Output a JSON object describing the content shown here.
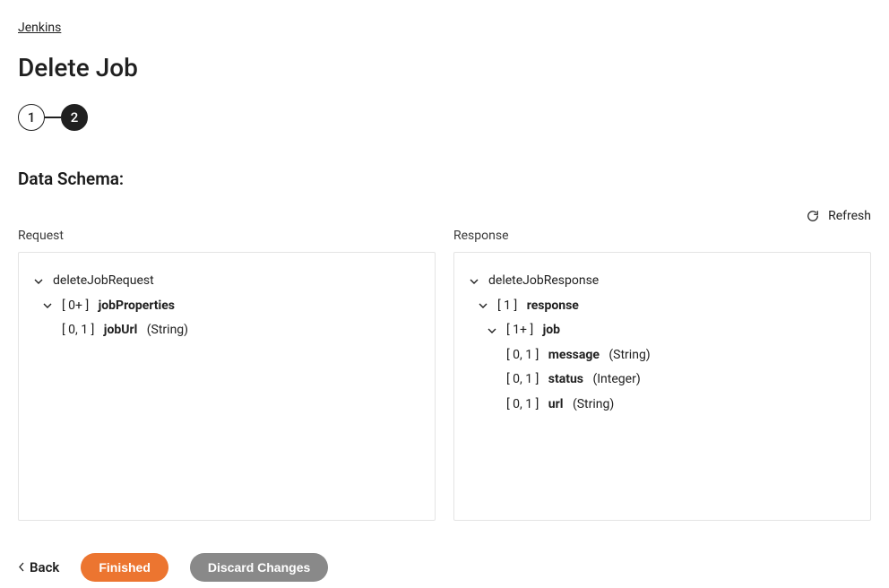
{
  "breadcrumb": {
    "label": "Jenkins"
  },
  "page": {
    "title": "Delete Job"
  },
  "stepper": {
    "step1": "1",
    "step2": "2"
  },
  "section": {
    "title": "Data Schema:"
  },
  "refresh": {
    "label": "Refresh"
  },
  "request": {
    "header": "Request",
    "root": "deleteJobRequest",
    "jobProperties": {
      "card": "[ 0+ ]",
      "name": "jobProperties"
    },
    "jobUrl": {
      "card": "[ 0, 1 ]",
      "name": "jobUrl",
      "type": "(String)"
    }
  },
  "response": {
    "header": "Response",
    "root": "deleteJobResponse",
    "responseNode": {
      "card": "[ 1 ]",
      "name": "response"
    },
    "job": {
      "card": "[ 1+ ]",
      "name": "job"
    },
    "message": {
      "card": "[ 0, 1 ]",
      "name": "message",
      "type": "(String)"
    },
    "status": {
      "card": "[ 0, 1 ]",
      "name": "status",
      "type": "(Integer)"
    },
    "url": {
      "card": "[ 0, 1 ]",
      "name": "url",
      "type": "(String)"
    }
  },
  "footer": {
    "back": "Back",
    "finished": "Finished",
    "discard": "Discard Changes"
  }
}
